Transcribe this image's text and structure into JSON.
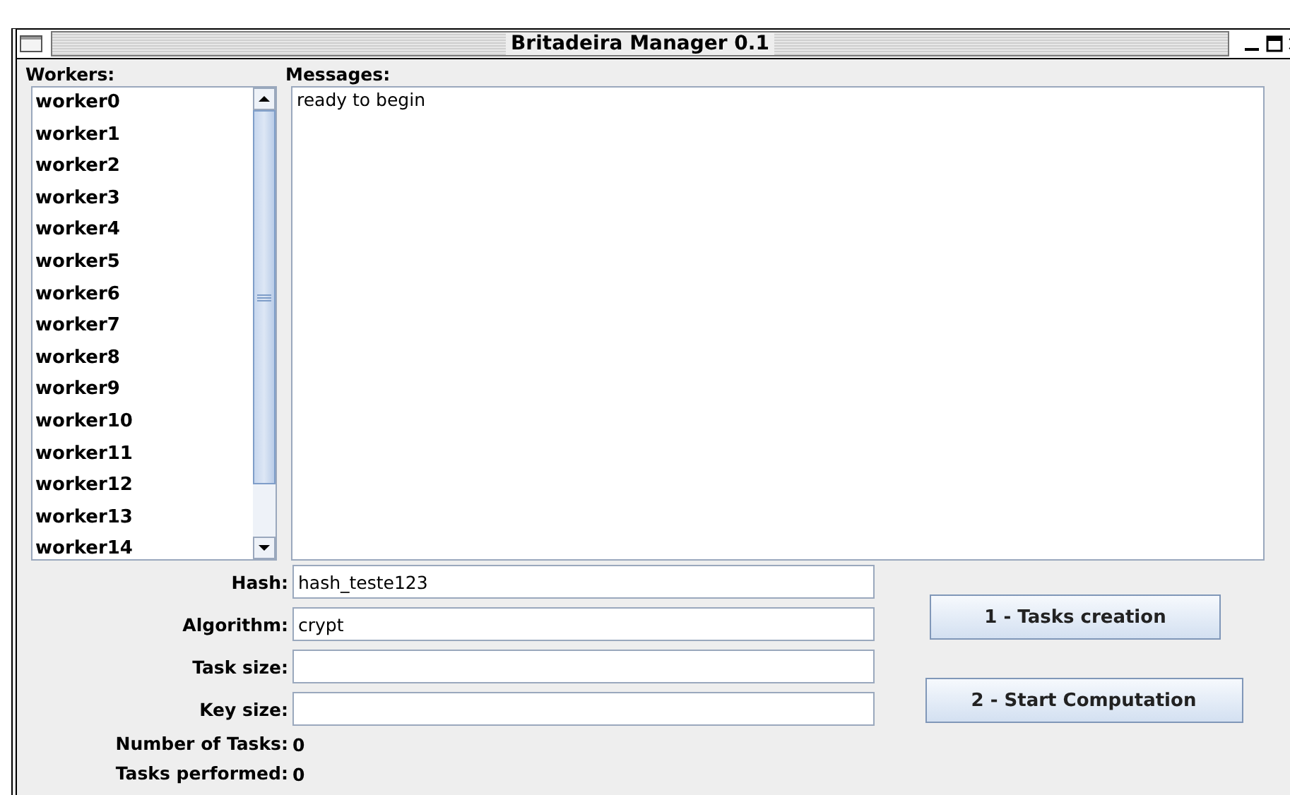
{
  "window": {
    "title": "Britadeira Manager 0.1"
  },
  "workers": {
    "label": "Workers:",
    "items": [
      {
        "name": "worker0"
      },
      {
        "name": "worker1"
      },
      {
        "name": "worker2"
      },
      {
        "name": "worker3"
      },
      {
        "name": "worker4"
      },
      {
        "name": "worker5"
      },
      {
        "name": "worker6"
      },
      {
        "name": "worker7"
      },
      {
        "name": "worker8"
      },
      {
        "name": "worker9"
      },
      {
        "name": "worker10"
      },
      {
        "name": "worker11"
      },
      {
        "name": "worker12"
      },
      {
        "name": "worker13"
      },
      {
        "name": "worker14"
      }
    ]
  },
  "messages": {
    "label": "Messages:",
    "text": "ready to begin"
  },
  "fields": [
    {
      "label": "Hash:",
      "value": "hash_teste123"
    },
    {
      "label": "Algorithm:",
      "value": "crypt"
    },
    {
      "label": "Task size:"
    },
    {
      "label": "Key size:"
    }
  ],
  "buttons": [
    "1 - Tasks creation",
    "2 - Start Computation"
  ],
  "stats": [
    {
      "label": "Number of Tasks:",
      "value": "0"
    },
    {
      "label": "Tasks performed:",
      "value": "0"
    }
  ]
}
